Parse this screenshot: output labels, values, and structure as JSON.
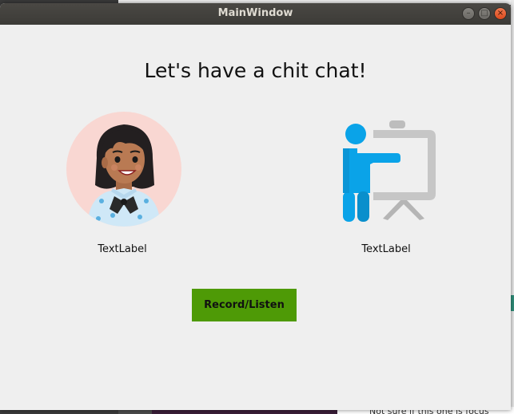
{
  "window": {
    "title": "MainWindow"
  },
  "content": {
    "heading": "Let's have a chit chat!",
    "left_label": "TextLabel",
    "right_label": "TextLabel",
    "record_button_label": "Record/Listen"
  },
  "icons": {
    "left": "woman-avatar",
    "right": "presenter-at-board"
  },
  "colors": {
    "record_button": "#4e9a06",
    "presenter_blue": "#0aa3e8",
    "board_gray": "#c6c6c6",
    "avatar_bg": "#f9d7d2",
    "titlebar": "#3c3b37",
    "close_button": "#dd4b1e"
  },
  "background": {
    "partial_text": "Not sure if this one is focus"
  }
}
